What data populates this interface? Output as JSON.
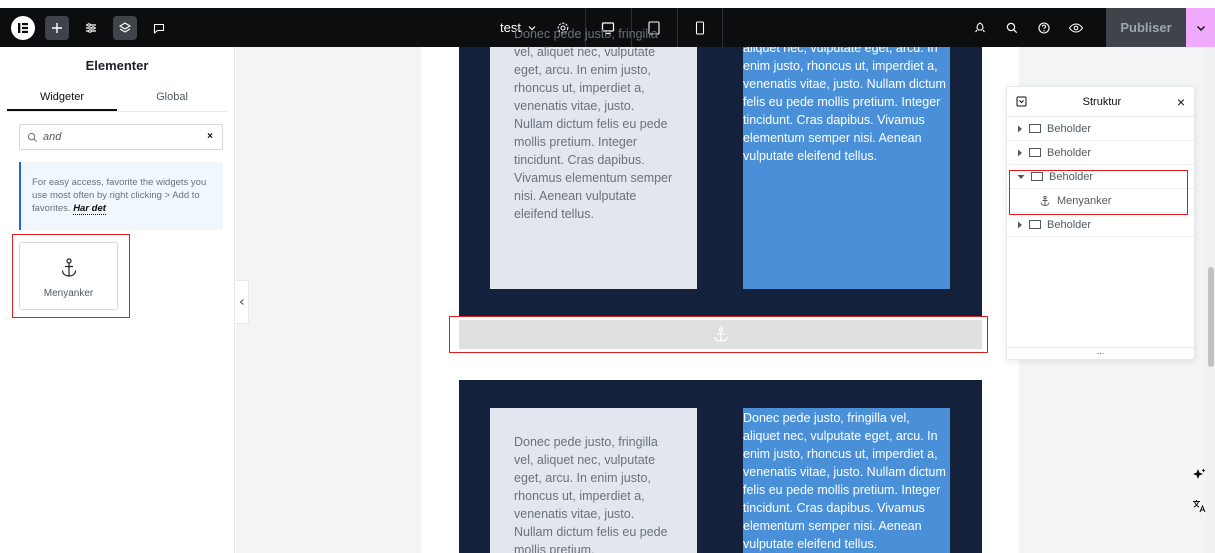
{
  "toolbar": {
    "doc_title": "test",
    "publish_label": "Publiser"
  },
  "panel": {
    "title": "Elementer",
    "tabs": [
      {
        "label": "Widgeter",
        "active": true
      },
      {
        "label": "Global",
        "active": false
      }
    ],
    "search": {
      "value": "and",
      "clear_glyph": "×"
    },
    "hint": {
      "text": "For easy access, favorite the widgets you use most often by right clicking > Add to favorites.",
      "link": "Har det"
    },
    "widgets": [
      {
        "label": "Menyanker",
        "icon": "anchor-icon"
      }
    ]
  },
  "canvas": {
    "light_text_top": "Donec pede justo, fringilla vel, aliquet nec, vulputate eget, arcu. In enim justo, rhoncus ut, imperdiet a, venenatis vitae, justo. Nullam dictum felis eu pede mollis pretium. Integer tincidunt. Cras dapibus. Vivamus elementum semper nisi. Aenean vulputate eleifend tellus.",
    "blue_text_top": "aliquet nec, vulputate eget, arcu. In enim justo, rhoncus ut, imperdiet a, venenatis vitae, justo. Nullam dictum felis eu pede mollis pretium. Integer tincidunt. Cras dapibus. Vivamus elementum semper nisi. Aenean vulputate eleifend tellus.",
    "light_text_bottom": "Donec pede justo, fringilla vel, aliquet nec, vulputate eget, arcu. In enim justo, rhoncus ut, imperdiet a, venenatis vitae, justo. Nullam dictum felis eu pede mollis pretium.",
    "blue_text_bottom": "Donec pede justo, fringilla vel, aliquet nec, vulputate eget, arcu. In enim justo, rhoncus ut, imperdiet a, venenatis vitae, justo. Nullam dictum felis eu pede mollis pretium. Integer tincidunt. Cras dapibus. Vivamus elementum semper nisi. Aenean vulputate eleifend tellus."
  },
  "structure": {
    "title": "Struktur",
    "close_glyph": "×",
    "items": [
      {
        "label": "Beholder",
        "expanded": false
      },
      {
        "label": "Beholder",
        "expanded": false
      },
      {
        "label": "Beholder",
        "expanded": true
      },
      {
        "label": "Menyanker",
        "child": true
      },
      {
        "label": "Beholder",
        "expanded": false
      }
    ],
    "footer": "..."
  },
  "colors": {
    "toolbar_bg": "#0c0d0e",
    "section_bg": "#14213d",
    "blue_column": "#4a90d9",
    "light_column": "#e3e6ee",
    "publish_drop": "#f0abfc",
    "highlight_red": "#e11d1d"
  }
}
